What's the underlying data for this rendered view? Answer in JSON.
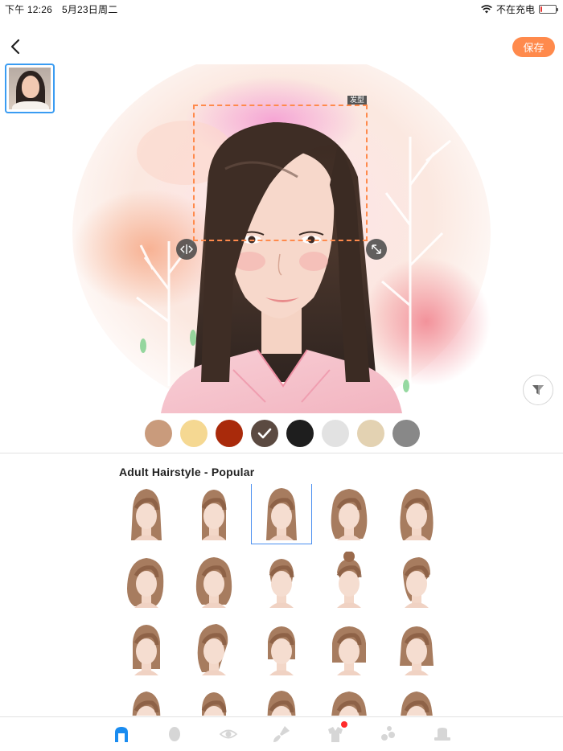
{
  "status": {
    "time": "下午 12:26",
    "date": "5月23日周二",
    "charging": "不在充电",
    "battery_level": 0.12
  },
  "header": {
    "back_icon": "chevron-left-icon",
    "save_label": "保存",
    "accent": "#ff8a4c"
  },
  "editor": {
    "region_label": "发型",
    "selection_color": "#ff8a4c"
  },
  "colors": {
    "swatches": [
      {
        "name": "light-brown",
        "hex": "#c99b7c"
      },
      {
        "name": "blonde",
        "hex": "#f5d892"
      },
      {
        "name": "auburn",
        "hex": "#a92a0b"
      },
      {
        "name": "dark-brown",
        "hex": "#5b4a41",
        "selected": true
      },
      {
        "name": "black",
        "hex": "#1e1e1e"
      },
      {
        "name": "light-gray",
        "hex": "#e2e2e2"
      },
      {
        "name": "beige",
        "hex": "#e3d2b2"
      },
      {
        "name": "gray",
        "hex": "#888888"
      }
    ]
  },
  "catalog": {
    "title": "Adult Hairstyle - Popular",
    "selected_index": 2
  },
  "tabbar": {
    "items": [
      "hair-icon",
      "face-icon",
      "eye-icon",
      "makeup-brush-icon",
      "clothes-icon",
      "accessories-icon",
      "hat-icon"
    ],
    "active_index": 0,
    "active_color": "#1a8cf0",
    "badge_index": 4
  }
}
